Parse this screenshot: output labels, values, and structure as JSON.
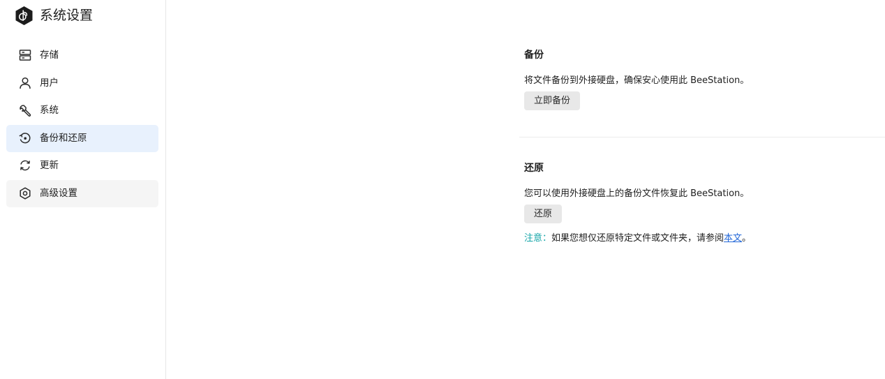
{
  "app": {
    "title": "系统设置"
  },
  "sidebar": {
    "items": [
      {
        "label": "存储",
        "icon": "storage-icon",
        "state": "normal"
      },
      {
        "label": "用户",
        "icon": "user-icon",
        "state": "normal"
      },
      {
        "label": "系统",
        "icon": "wrench-icon",
        "state": "normal"
      },
      {
        "label": "备份和还原",
        "icon": "backup-restore-icon",
        "state": "active"
      },
      {
        "label": "更新",
        "icon": "update-icon",
        "state": "normal"
      },
      {
        "label": "高级设置",
        "icon": "advanced-settings-icon",
        "state": "hover"
      }
    ]
  },
  "backup": {
    "title": "备份",
    "description": "将文件备份到外接硬盘，确保安心使用此 BeeStation。",
    "button_label": "立即备份"
  },
  "restore": {
    "title": "还原",
    "description": "您可以使用外接硬盘上的备份文件恢复此 BeeStation。",
    "button_label": "还原",
    "note_prefix": "注意：",
    "note_text": "如果您想仅还原特定文件或文件夹，请参阅",
    "note_link": "本文",
    "note_suffix": "。"
  },
  "colors": {
    "active_nav_bg": "#e8f1fd",
    "hover_nav_bg": "#f5f5f5",
    "note_prefix": "#14a5a8",
    "link": "#2468d8",
    "button_bg": "#e8e8e8"
  }
}
